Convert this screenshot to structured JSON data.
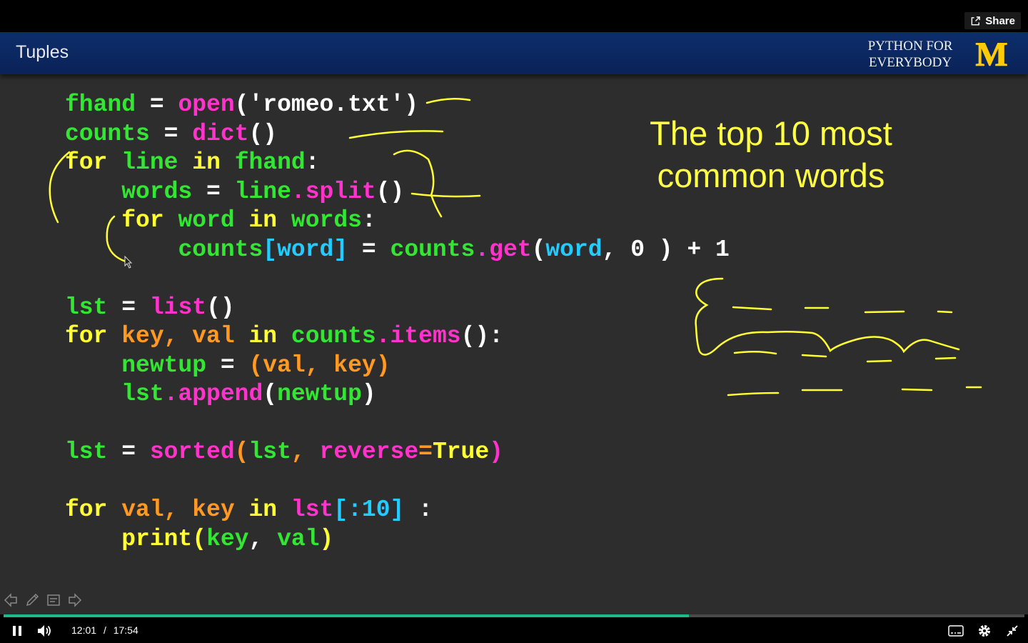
{
  "player": {
    "share_label": "Share",
    "current_time": "12:01",
    "time_separator": "/",
    "duration": "17:54",
    "progress_fraction": 0.671,
    "accent_color": "#1fb88a"
  },
  "slide": {
    "title": "Tuples",
    "brand_line1": "PYTHON FOR",
    "brand_line2": "EVERYBODY",
    "brand_logo_text": "M",
    "annotation": {
      "line1": "The top 10 most",
      "line2": "common words"
    },
    "code_lines": [
      [
        [
          "t-var",
          "fhand"
        ],
        [
          "t-op",
          " = "
        ],
        [
          "t-fn",
          "open"
        ],
        [
          "t-str",
          "('romeo.txt')"
        ]
      ],
      [
        [
          "t-var",
          "counts"
        ],
        [
          "t-op",
          " = "
        ],
        [
          "t-fn",
          "dict"
        ],
        [
          "t-op",
          "()"
        ]
      ],
      [
        [
          "t-kw",
          "for"
        ],
        [
          "t-op",
          " "
        ],
        [
          "t-var",
          "line"
        ],
        [
          "t-op",
          " "
        ],
        [
          "t-kw",
          "in"
        ],
        [
          "t-op",
          " "
        ],
        [
          "t-var",
          "fhand"
        ],
        [
          "t-op",
          ":"
        ]
      ],
      [
        [
          "t-op",
          "    "
        ],
        [
          "t-var",
          "words"
        ],
        [
          "t-op",
          " = "
        ],
        [
          "t-var",
          "line"
        ],
        [
          "t-fn",
          ".split"
        ],
        [
          "t-op",
          "()"
        ]
      ],
      [
        [
          "t-op",
          "    "
        ],
        [
          "t-kw",
          "for"
        ],
        [
          "t-op",
          " "
        ],
        [
          "t-var",
          "word"
        ],
        [
          "t-op",
          " "
        ],
        [
          "t-kw",
          "in"
        ],
        [
          "t-op",
          " "
        ],
        [
          "t-var",
          "words"
        ],
        [
          "t-op",
          ":"
        ]
      ],
      [
        [
          "t-op",
          "        "
        ],
        [
          "t-var",
          "counts"
        ],
        [
          "t-cy",
          "[word]"
        ],
        [
          "t-op",
          " = "
        ],
        [
          "t-var",
          "counts"
        ],
        [
          "t-fn",
          ".get"
        ],
        [
          "t-op",
          "("
        ],
        [
          "t-cy",
          "word"
        ],
        [
          "t-op",
          ", 0 ) + 1"
        ]
      ],
      [],
      [
        [
          "t-var",
          "lst"
        ],
        [
          "t-op",
          " = "
        ],
        [
          "t-fn",
          "list"
        ],
        [
          "t-op",
          "()"
        ]
      ],
      [
        [
          "t-kw",
          "for"
        ],
        [
          "t-op",
          " "
        ],
        [
          "t-or",
          "key, val"
        ],
        [
          "t-op",
          " "
        ],
        [
          "t-kw",
          "in"
        ],
        [
          "t-op",
          " "
        ],
        [
          "t-var",
          "counts"
        ],
        [
          "t-fn",
          ".items"
        ],
        [
          "t-op",
          "():"
        ]
      ],
      [
        [
          "t-op",
          "    "
        ],
        [
          "t-var",
          "newtup"
        ],
        [
          "t-op",
          " = "
        ],
        [
          "t-or",
          "(val, key)"
        ]
      ],
      [
        [
          "t-op",
          "    "
        ],
        [
          "t-var",
          "lst"
        ],
        [
          "t-fn",
          ".append"
        ],
        [
          "t-op",
          "("
        ],
        [
          "t-var",
          "newtup"
        ],
        [
          "t-op",
          ")"
        ]
      ],
      [],
      [
        [
          "t-var",
          "lst"
        ],
        [
          "t-op",
          " = "
        ],
        [
          "t-fn",
          "sorted"
        ],
        [
          "t-or",
          "("
        ],
        [
          "t-var",
          "lst"
        ],
        [
          "t-or",
          ", "
        ],
        [
          "t-fn",
          "reverse"
        ],
        [
          "t-or",
          "="
        ],
        [
          "t-kw",
          "True"
        ],
        [
          "t-fn",
          ")"
        ]
      ],
      [],
      [
        [
          "t-kw",
          "for"
        ],
        [
          "t-op",
          " "
        ],
        [
          "t-or",
          "val, key"
        ],
        [
          "t-op",
          " "
        ],
        [
          "t-kw",
          "in"
        ],
        [
          "t-op",
          " "
        ],
        [
          "t-fn",
          "lst"
        ],
        [
          "t-cy",
          "[:10]"
        ],
        [
          "t-op",
          " :"
        ]
      ],
      [
        [
          "t-op",
          "    "
        ],
        [
          "t-kw",
          "print"
        ],
        [
          "t-kw",
          "("
        ],
        [
          "t-var",
          "key"
        ],
        [
          "t-op",
          ", "
        ],
        [
          "t-var",
          "val"
        ],
        [
          "t-kw",
          ")"
        ]
      ]
    ]
  }
}
